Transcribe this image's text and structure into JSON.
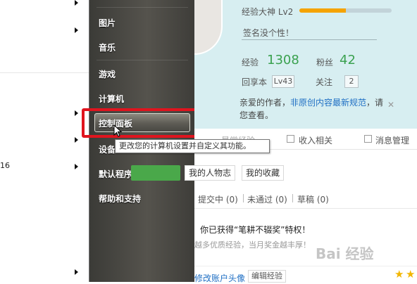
{
  "start_menu": {
    "items": [
      {
        "label": "图片"
      },
      {
        "label": "音乐"
      },
      {
        "label": "游戏"
      },
      {
        "label": "计算机"
      },
      {
        "label": "控制面板"
      },
      {
        "label": "设备"
      },
      {
        "label": "默认程序"
      },
      {
        "label": "帮助和支持"
      }
    ],
    "tooltip": "更改您的计算机设置并自定义其功能。"
  },
  "left_panel": {
    "number": "16"
  },
  "profile": {
    "level_label": "经验大神 Lv2",
    "level_progress": 0.5,
    "signature": "签名没个性！",
    "exp_label": "经验",
    "exp_value": "1308",
    "fans_label": "粉丝",
    "fans_value": "42",
    "reply_label": "回享本",
    "reply_level": "Lv43",
    "follow_label": "关注",
    "follow_value": "2",
    "notice_prefix": "亲爱的作者，",
    "notice_link": "非原创内容最新规范",
    "notice_suffix": "，请",
    "notice_line2": "您查看。",
    "notice_close": "✕"
  },
  "tabs": {
    "items": [
      {
        "label": "最常经验"
      },
      {
        "label": "收入相关"
      },
      {
        "label": "消息管理"
      }
    ]
  },
  "content": {
    "subtabs": [
      {
        "label": "我的人物志"
      },
      {
        "label": "我的收藏"
      }
    ],
    "filters": [
      {
        "label": "提交中 (0)"
      },
      {
        "label": "未通过 (0)"
      },
      {
        "label": "草稿 (0)"
      }
    ],
    "award_title": "你已获得“笔耕不辍奖”特权！",
    "award_desc": "越多优质经验，当月奖金越丰厚！",
    "bottom_link": "修改账户头像",
    "bottom_button": "编辑经验"
  },
  "watermark": "Bai 经验",
  "colors": {
    "highlight_border": "#e0141e",
    "green_text": "#3aa14f",
    "progress": "#f5a300"
  }
}
